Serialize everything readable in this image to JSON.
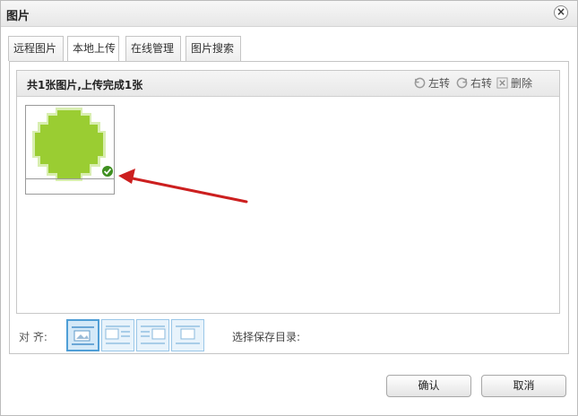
{
  "dialog": {
    "title": "图片",
    "close_symbol": "×"
  },
  "tabs": [
    {
      "label": "远程图片",
      "active": false
    },
    {
      "label": "本地上传",
      "active": true
    },
    {
      "label": "在线管理",
      "active": false
    },
    {
      "label": "图片搜索",
      "active": false
    }
  ],
  "upload": {
    "status_text": "共1张图片,上传完成1张",
    "actions": [
      {
        "label": "左转",
        "icon": "rotate-left-icon"
      },
      {
        "label": "右转",
        "icon": "rotate-right-icon"
      },
      {
        "label": "删除",
        "icon": "delete-icon"
      }
    ],
    "items": [
      {
        "icon": "green-circle-image",
        "status": "upload-complete-check-icon"
      }
    ]
  },
  "align": {
    "label": "对 齐:",
    "options": [
      {
        "icon": "align-none-icon",
        "selected": true
      },
      {
        "icon": "align-left-icon",
        "selected": false
      },
      {
        "icon": "align-right-icon",
        "selected": false
      },
      {
        "icon": "align-center-icon",
        "selected": false
      }
    ]
  },
  "save_dir": {
    "label": "选择保存目录:"
  },
  "footer": {
    "confirm_label": "确认",
    "cancel_label": "取消"
  },
  "colors": {
    "accent": "#4f9ed6",
    "image_green": "#9acd32",
    "check_green": "#3e8f1f",
    "arrow_red": "#cc1f1f"
  }
}
